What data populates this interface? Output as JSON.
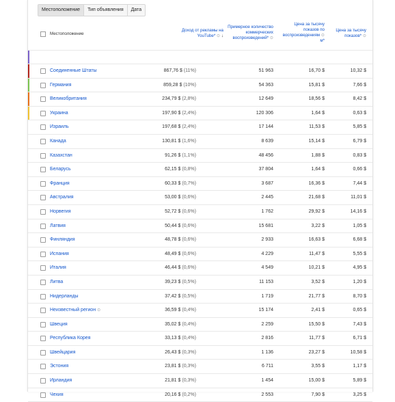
{
  "tabs": [
    {
      "label": "Местоположение",
      "active": true
    },
    {
      "label": "Тип объявления",
      "active": false
    },
    {
      "label": "Дата",
      "active": false
    }
  ],
  "columns": {
    "location": "Местоположение",
    "revenue_l1": "Доход от рекламы на",
    "revenue_l2": "YouTube*",
    "impr_l1": "Примерное количество",
    "impr_l2": "коммерческих",
    "impr_l3": "воспроизведений*",
    "cpm_l1": "Цена за тысячу",
    "cpm_l2": "показов по",
    "cpm_l3": "воспроизведениям",
    "cpm_l4": "м*",
    "cpm2_l1": "Цена за тысячу",
    "cpm2_l2": "показов*"
  },
  "rows": [
    {
      "name": "Соединенные Штаты",
      "revenue": "867,76 $",
      "pct": "(11%)",
      "plays": "51 963",
      "cpm_play": "16,70 $",
      "cpm": "10,32 $",
      "color": "#b3261e"
    },
    {
      "name": "Германия",
      "revenue": "859,28 $",
      "pct": "(10%)",
      "plays": "54 363",
      "cpm_play": "15,81 $",
      "cpm": "7,66 $",
      "color": "#7cc44f"
    },
    {
      "name": "Великобритания",
      "revenue": "234,79 $",
      "pct": "(2,8%)",
      "plays": "12 649",
      "cpm_play": "18,56 $",
      "cpm": "8,42 $",
      "color": "#e8711a"
    },
    {
      "name": "Украина",
      "revenue": "197,90 $",
      "pct": "(2,4%)",
      "plays": "120 306",
      "cpm_play": "1,64 $",
      "cpm": "0,63 $",
      "color": "#f2c230"
    },
    {
      "name": "Израиль",
      "revenue": "197,68 $",
      "pct": "(2,4%)",
      "plays": "17 144",
      "cpm_play": "11,53 $",
      "cpm": "5,85 $",
      "color": ""
    },
    {
      "name": "Канада",
      "revenue": "130,81 $",
      "pct": "(1,6%)",
      "plays": "8 639",
      "cpm_play": "15,14 $",
      "cpm": "6,79 $",
      "color": ""
    },
    {
      "name": "Казахстан",
      "revenue": "91,26 $",
      "pct": "(1,1%)",
      "plays": "48 456",
      "cpm_play": "1,88 $",
      "cpm": "0,83 $",
      "color": ""
    },
    {
      "name": "Беларусь",
      "revenue": "62,15 $",
      "pct": "(0,8%)",
      "plays": "37 804",
      "cpm_play": "1,64 $",
      "cpm": "0,66 $",
      "color": ""
    },
    {
      "name": "Франция",
      "revenue": "60,33 $",
      "pct": "(0,7%)",
      "plays": "3 687",
      "cpm_play": "16,36 $",
      "cpm": "7,44 $",
      "color": ""
    },
    {
      "name": "Австралия",
      "revenue": "53,00 $",
      "pct": "(0,6%)",
      "plays": "2 445",
      "cpm_play": "21,68 $",
      "cpm": "11,01 $",
      "color": ""
    },
    {
      "name": "Норвегия",
      "revenue": "52,72 $",
      "pct": "(0,6%)",
      "plays": "1 762",
      "cpm_play": "29,92 $",
      "cpm": "14,16 $",
      "color": ""
    },
    {
      "name": "Латвия",
      "revenue": "50,44 $",
      "pct": "(0,6%)",
      "plays": "15 681",
      "cpm_play": "3,22 $",
      "cpm": "1,05 $",
      "color": ""
    },
    {
      "name": "Финляндия",
      "revenue": "48,78 $",
      "pct": "(0,6%)",
      "plays": "2 933",
      "cpm_play": "16,63 $",
      "cpm": "6,68 $",
      "color": ""
    },
    {
      "name": "Испания",
      "revenue": "48,49 $",
      "pct": "(0,6%)",
      "plays": "4 229",
      "cpm_play": "11,47 $",
      "cpm": "5,55 $",
      "color": ""
    },
    {
      "name": "Италия",
      "revenue": "46,44 $",
      "pct": "(0,6%)",
      "plays": "4 549",
      "cpm_play": "10,21 $",
      "cpm": "4,95 $",
      "color": ""
    },
    {
      "name": "Литва",
      "revenue": "39,23 $",
      "pct": "(0,5%)",
      "plays": "11 153",
      "cpm_play": "3,52 $",
      "cpm": "1,20 $",
      "color": ""
    },
    {
      "name": "Нидерланды",
      "revenue": "37,42 $",
      "pct": "(0,5%)",
      "plays": "1 719",
      "cpm_play": "21,77 $",
      "cpm": "8,70 $",
      "color": ""
    },
    {
      "name": "Неизвестный регион",
      "revenue": "36,59 $",
      "pct": "(0,4%)",
      "plays": "15 174",
      "cpm_play": "2,41 $",
      "cpm": "0,65 $",
      "color": "",
      "help": true
    },
    {
      "name": "Швеция",
      "revenue": "35,02 $",
      "pct": "(0,4%)",
      "plays": "2 259",
      "cpm_play": "15,50 $",
      "cpm": "7,43 $",
      "color": ""
    },
    {
      "name": "Республика Корея",
      "revenue": "33,13 $",
      "pct": "(0,4%)",
      "plays": "2 816",
      "cpm_play": "11,77 $",
      "cpm": "6,71 $",
      "color": ""
    },
    {
      "name": "Швейцария",
      "revenue": "26,43 $",
      "pct": "(0,3%)",
      "plays": "1 136",
      "cpm_play": "23,27 $",
      "cpm": "10,58 $",
      "color": ""
    },
    {
      "name": "Эстония",
      "revenue": "23,81 $",
      "pct": "(0,3%)",
      "plays": "6 711",
      "cpm_play": "3,55 $",
      "cpm": "1,17 $",
      "color": ""
    },
    {
      "name": "Ирландия",
      "revenue": "21,81 $",
      "pct": "(0,3%)",
      "plays": "1 454",
      "cpm_play": "15,00 $",
      "cpm": "5,89 $",
      "color": ""
    },
    {
      "name": "Чехия",
      "revenue": "20,16 $",
      "pct": "(0,2%)",
      "plays": "2 553",
      "cpm_play": "7,90 $",
      "cpm": "3,25 $",
      "color": ""
    }
  ],
  "colors": {
    "link": "#1155cc",
    "blank_row_stripe": "#7b61c9"
  }
}
